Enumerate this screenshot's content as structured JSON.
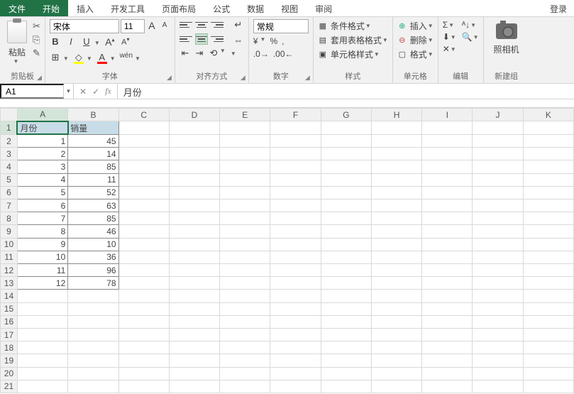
{
  "menu": {
    "file": "文件",
    "tabs": [
      "开始",
      "插入",
      "开发工具",
      "页面布局",
      "公式",
      "数据",
      "视图",
      "审阅"
    ],
    "active": 0,
    "login": "登录"
  },
  "ribbon": {
    "clipboard": {
      "paste": "粘贴",
      "label": "剪贴板",
      "cut_icon": "✂",
      "copy_icon": "⎘",
      "brush_icon": "✎"
    },
    "font": {
      "name": "宋体",
      "size": "11",
      "bold": "B",
      "italic": "I",
      "underline": "U",
      "grow": "A",
      "shrink": "A",
      "border_icon": "⊞",
      "fill_icon": "A",
      "color_icon": "A",
      "phonetic": "wén",
      "label": "字体"
    },
    "align": {
      "wrap_icon": "↵",
      "merge_icon": "⇔",
      "label": "对齐方式"
    },
    "number": {
      "format": "常规",
      "currency": "¥",
      "percent": "%",
      "comma": ",",
      "inc": "←",
      "dec": "→",
      "label": "数字"
    },
    "styles": {
      "cond": "条件格式",
      "table": "套用表格格式",
      "cell": "单元格样式",
      "label": "样式"
    },
    "cells": {
      "insert": "插入",
      "delete": "删除",
      "format": "格式",
      "label": "单元格"
    },
    "editing": {
      "sum": "Σ",
      "fill": "⬇",
      "clear": "✕",
      "sort": "ᴬ↓",
      "find": "🔍",
      "label": "编辑"
    },
    "camera": {
      "name": "照相机",
      "label": "新建组"
    }
  },
  "formula_bar": {
    "cell_ref": "A1",
    "cancel": "✕",
    "confirm": "✓",
    "fx": "fx",
    "value": "月份"
  },
  "grid": {
    "columns": [
      "A",
      "B",
      "C",
      "D",
      "E",
      "F",
      "G",
      "H",
      "I",
      "J",
      "K"
    ],
    "selected_col": 0,
    "selected_row": 1,
    "headers": {
      "a": "月份",
      "b": "销量"
    },
    "rows": [
      {
        "a": "1",
        "b": "45"
      },
      {
        "a": "2",
        "b": "14"
      },
      {
        "a": "3",
        "b": "85"
      },
      {
        "a": "4",
        "b": "11"
      },
      {
        "a": "5",
        "b": "52"
      },
      {
        "a": "6",
        "b": "63"
      },
      {
        "a": "7",
        "b": "85"
      },
      {
        "a": "8",
        "b": "46"
      },
      {
        "a": "9",
        "b": "10"
      },
      {
        "a": "10",
        "b": "36"
      },
      {
        "a": "11",
        "b": "96"
      },
      {
        "a": "12",
        "b": "78"
      }
    ],
    "total_rows": 21
  },
  "chart_data": {
    "type": "table",
    "title": "月份 vs 销量",
    "columns": [
      "月份",
      "销量"
    ],
    "categories": [
      1,
      2,
      3,
      4,
      5,
      6,
      7,
      8,
      9,
      10,
      11,
      12
    ],
    "values": [
      45,
      14,
      85,
      11,
      52,
      63,
      85,
      46,
      10,
      36,
      96,
      78
    ]
  }
}
